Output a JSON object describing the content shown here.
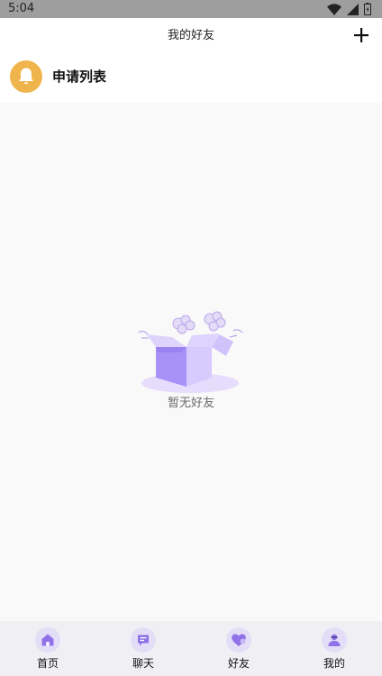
{
  "status_bar": {
    "time": "5:04",
    "icons": [
      "wifi-icon",
      "signal-icon",
      "battery-icon"
    ]
  },
  "header": {
    "title": "我的好友",
    "add_icon": "plus-icon"
  },
  "request_row": {
    "icon": "bell-icon",
    "label": "申请列表",
    "icon_bg_color": "#efb54c"
  },
  "empty_state": {
    "illustration": "empty-box-icon",
    "text": "暂无好友"
  },
  "tab_bar": {
    "accent_color": "#8f72e8",
    "tabs": [
      {
        "label": "首页",
        "icon": "home-icon"
      },
      {
        "label": "聊天",
        "icon": "chat-icon"
      },
      {
        "label": "好友",
        "icon": "heart-icon"
      },
      {
        "label": "我的",
        "icon": "user-icon"
      }
    ]
  }
}
